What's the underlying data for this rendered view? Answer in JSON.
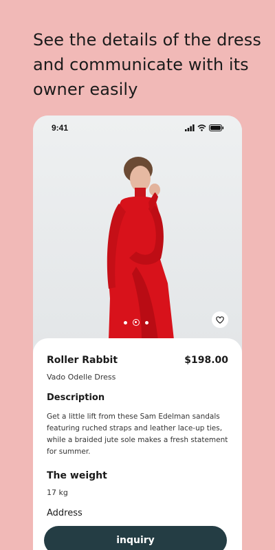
{
  "headline": "See the details of the dress and communicate with its owner easily",
  "status_bar": {
    "time": "9:41",
    "icons": [
      "signal-icon",
      "wifi-icon",
      "battery-icon"
    ]
  },
  "gallery": {
    "image_count": 3,
    "active_index": 1
  },
  "product": {
    "brand": "Roller Rabbit",
    "price": "$198.00",
    "name": "Vado Odelle Dress",
    "description_title": "Description",
    "description": "Get a little lift from these Sam Edelman sandals featuring ruched straps and leather lace-up ties, while a braided jute sole makes a fresh statement for summer.",
    "weight_title": "The weight",
    "weight_value": "17 kg",
    "address_title": "Address"
  },
  "actions": {
    "inquiry_label": "inquiry",
    "favorite_icon": "heart-icon"
  },
  "colors": {
    "background": "#f1b9b7",
    "button": "#243d44",
    "dress": "#d8121b"
  }
}
